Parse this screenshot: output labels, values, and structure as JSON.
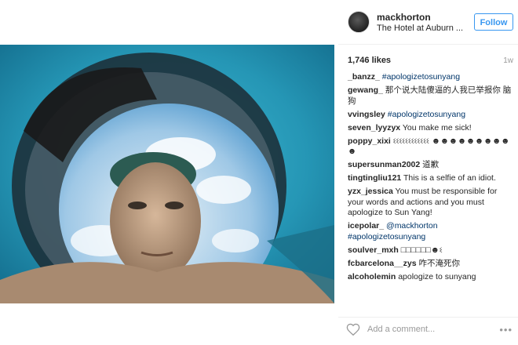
{
  "header": {
    "username": "mackhorton",
    "location": "The Hotel at Auburn ...",
    "follow_label": "Follow"
  },
  "stats": {
    "likes": "1,746 likes",
    "age": "1w"
  },
  "comments": [
    {
      "user": "_banzz_",
      "text": "",
      "tag": "#apologizetosunyang"
    },
    {
      "user": "gewang_",
      "text": "那个说大陆傻逼的人我已举报你 脑狗",
      "tag": ""
    },
    {
      "user": "vvingsley",
      "text": "",
      "tag": "#apologizetosunyang"
    },
    {
      "user": "seven_lyyzyx",
      "text": "You make me sick!",
      "tag": ""
    },
    {
      "user": "poppy_xixi",
      "text": "ଽଽଽଽଽଽଽଽଽଽଽଽ ☻☻☻☻☻☻☻☻☻☻",
      "tag": ""
    },
    {
      "user": "supersunman2002",
      "text": "道歉",
      "tag": ""
    },
    {
      "user": "tingtingliu121",
      "text": "This is a selfie of an idiot.",
      "tag": ""
    },
    {
      "user": "yzx_jessica",
      "text": "You must be responsible for your words and actions and you must apologize to Sun Yang!",
      "tag": ""
    },
    {
      "user": "icepolar_",
      "text": "@mackhorton",
      "tag": "#apologizetosunyang"
    },
    {
      "user": "soulver_mxh",
      "text": "□□□□□□☻ଽ",
      "tag": ""
    },
    {
      "user": "fcbarcelona__zys",
      "text": "咋不淹死你",
      "tag": ""
    },
    {
      "user": "alcoholemin",
      "text": "apologize to sunyang",
      "tag": ""
    }
  ],
  "footer": {
    "add_comment_placeholder": "Add a comment...",
    "more_label": "•••"
  },
  "colors": {
    "accent": "#3897f0",
    "link": "#003569"
  },
  "icons": [
    "heart-icon",
    "more-options-icon",
    "avatar"
  ]
}
